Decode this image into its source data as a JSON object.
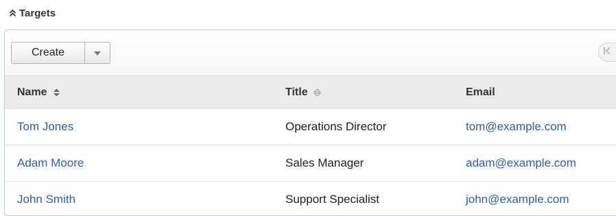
{
  "subpanel": {
    "title": "Targets",
    "collapse_icon": "double-chevron-up-icon"
  },
  "toolbar": {
    "create_label": "Create",
    "dropdown_icon": "caret-down-icon",
    "pager_first_icon": "first-page-icon"
  },
  "table": {
    "columns": [
      {
        "label": "Name",
        "sort_icon": "sort-active-icon"
      },
      {
        "label": "Title",
        "sort_icon": "sort-icon"
      },
      {
        "label": "Email"
      }
    ],
    "rows": [
      {
        "name": "Tom Jones",
        "title": "Operations Director",
        "email": "tom@example.com"
      },
      {
        "name": "Adam Moore",
        "title": "Sales Manager",
        "email": "adam@example.com"
      },
      {
        "name": "John Smith",
        "title": "Support Specialist",
        "email": "john@example.com"
      }
    ]
  },
  "colors": {
    "link": "#2a61b6",
    "header_bg": "#ebebeb",
    "panel_border": "#b9cde5"
  }
}
